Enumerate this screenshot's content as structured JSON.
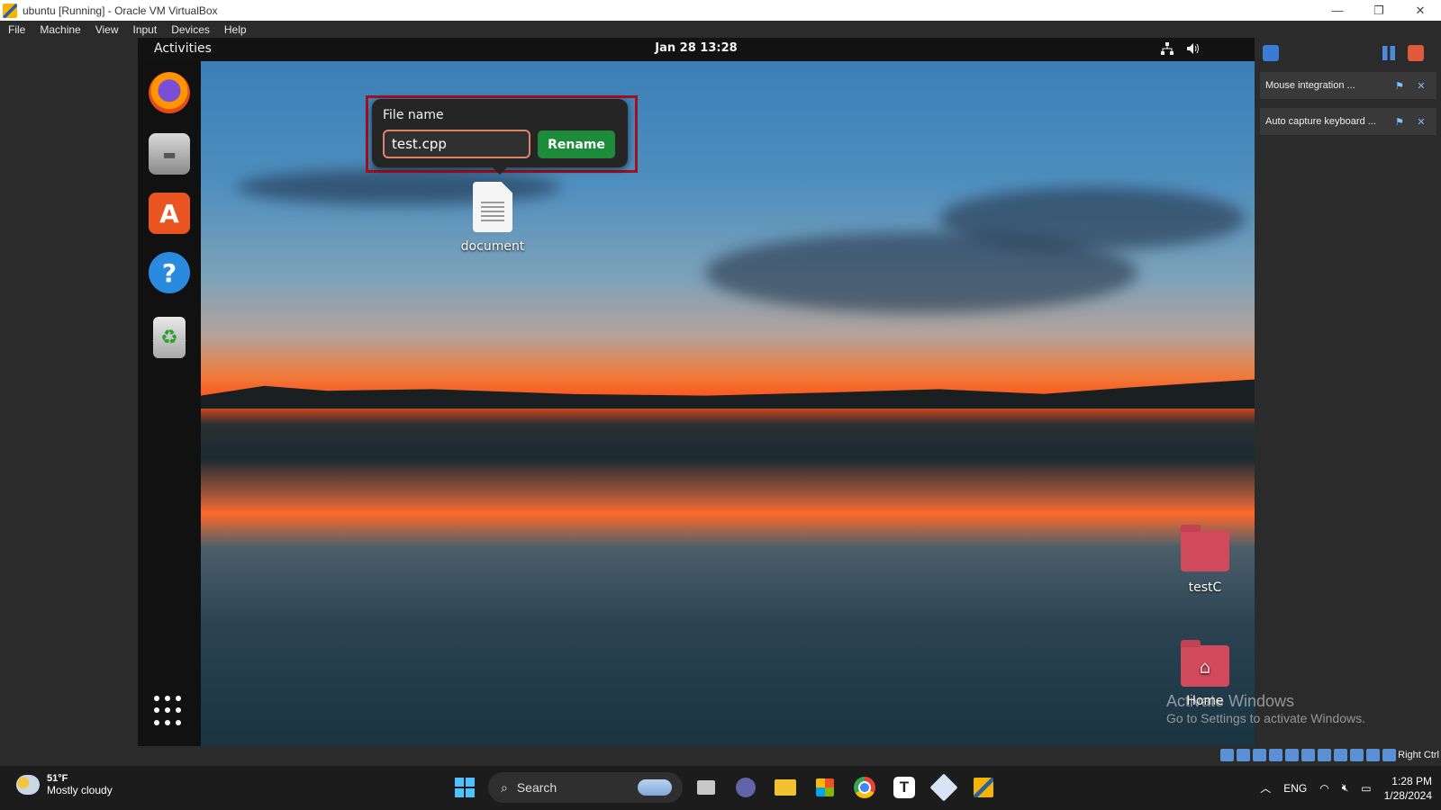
{
  "window": {
    "title": "ubuntu [Running] - Oracle VM VirtualBox",
    "minimize": "—",
    "restore": "❐",
    "close": "✕"
  },
  "menubar": [
    "File",
    "Machine",
    "View",
    "Input",
    "Devices",
    "Help"
  ],
  "gnome": {
    "activities": "Activities",
    "clock": "Jan 28  13:28",
    "tray": [
      "network-icon",
      "volume-icon"
    ]
  },
  "dock": [
    {
      "name": "firefox-icon",
      "glyph": "🦊",
      "color": "#e66000"
    },
    {
      "name": "files-icon",
      "glyph": "▬",
      "color": "#8a8a8a"
    },
    {
      "name": "software-icon",
      "glyph": "A",
      "color": "#e95420"
    },
    {
      "name": "help-icon",
      "glyph": "?",
      "color": "#2a8ae0"
    },
    {
      "name": "trash-icon",
      "glyph": "♻",
      "color": "#9e9e9e"
    }
  ],
  "rename_popover": {
    "label": "File name",
    "value": "test.cpp",
    "button": "Rename"
  },
  "desktop_icons": {
    "document": "document",
    "testC": "testC",
    "home": "Home"
  },
  "notifications": [
    {
      "text": "Mouse integration ..."
    },
    {
      "text": "Auto capture keyboard ..."
    }
  ],
  "watermark": {
    "line1": "Activate Windows",
    "line2": "Go to Settings to activate Windows."
  },
  "vb_status": {
    "host_key": "Right Ctrl"
  },
  "taskbar": {
    "weather_temp": "51°F",
    "weather_cond": "Mostly cloudy",
    "search": "Search",
    "lang": "ENG",
    "time": "1:28 PM",
    "date": "1/28/2024"
  },
  "colors": {
    "rename_button": "#1d8c3a",
    "input_border": "#e2826a",
    "highlight_frame": "#a3101f"
  }
}
